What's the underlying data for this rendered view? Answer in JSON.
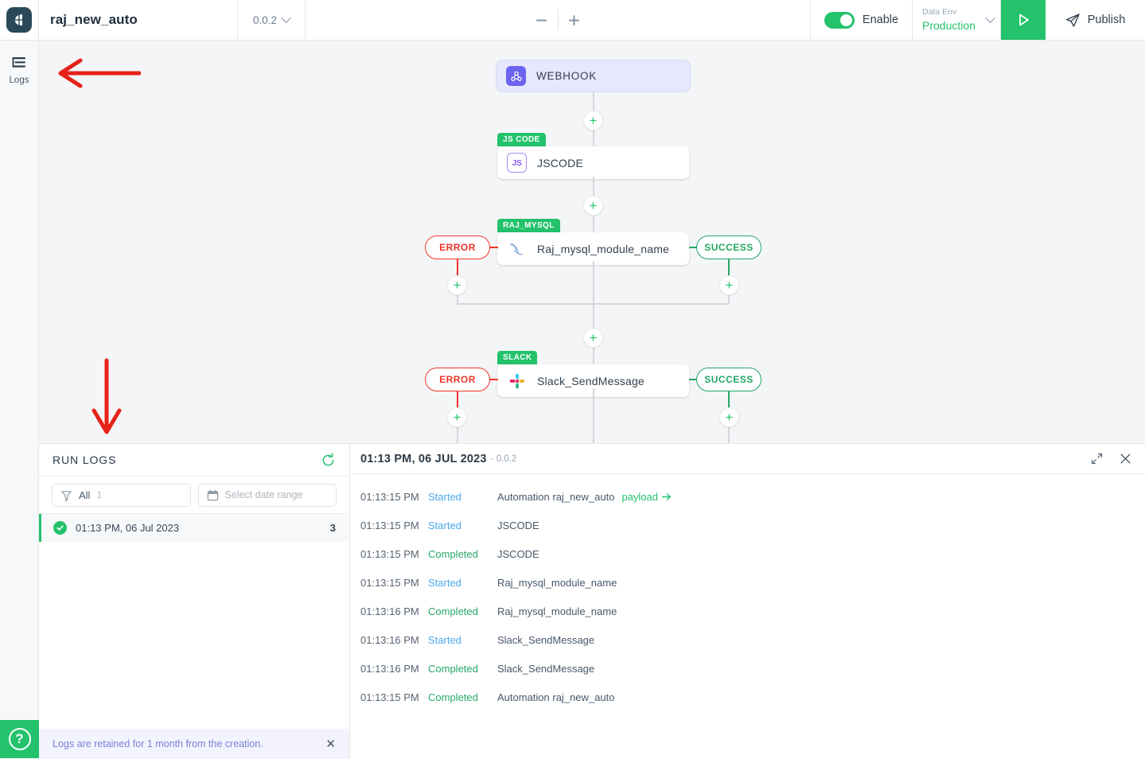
{
  "topbar": {
    "logo_icon": "app-logo-icon",
    "automation_title": "raj_new_auto",
    "version": "0.0.2",
    "version_chevron_icon": "chevron-down-icon",
    "zoom_out_icon": "minus-icon",
    "zoom_in_icon": "plus-icon",
    "enable_label": "Enable",
    "enable_toggle_state": "on",
    "data_env_label": "Data Env",
    "data_env_value": "Production",
    "data_env_chevron_icon": "chevron-down-icon",
    "run_icon": "play-icon",
    "publish_label": "Publish",
    "publish_icon": "send-icon"
  },
  "sidebar": {
    "items": [
      {
        "label": "Logs",
        "icon": "logs-icon"
      }
    ],
    "help_icon": "question-mark-icon"
  },
  "canvas": {
    "nodes": [
      {
        "id": "webhook",
        "tag": "",
        "title": "WEBHOOK",
        "icon": "webhook-icon"
      },
      {
        "id": "jscode",
        "tag": "JS CODE",
        "title": "JSCODE",
        "icon": "js-icon"
      },
      {
        "id": "mysql",
        "tag": "RAJ_MYSQL",
        "title": "Raj_mysql_module_name",
        "icon": "mysql-dolphin-icon"
      },
      {
        "id": "slack",
        "tag": "SLACK",
        "title": "Slack_SendMessage",
        "icon": "slack-icon"
      }
    ],
    "branch_error_label": "ERROR",
    "branch_success_label": "SUCCESS",
    "add_step_label": "+"
  },
  "runlogs": {
    "panel_title": "RUN LOGS",
    "refresh_icon": "refresh-icon",
    "filter_icon": "filter-icon",
    "filter_label": "All",
    "filter_count": "1",
    "calendar_icon": "calendar-icon",
    "date_placeholder": "Select date range",
    "items": [
      {
        "label": "01:13 PM, 06 Jul 2023",
        "count": "3",
        "status_icon": "check-circle-icon"
      }
    ],
    "retention_notice": "Logs are retained for 1 month from the creation.",
    "retention_close_icon": "close-icon"
  },
  "detail": {
    "title": "01:13 PM, 06 JUL 2023",
    "version_suffix": "- 0.0.2",
    "expand_icon": "expand-icon",
    "close_icon": "close-icon",
    "payload_label": "payload",
    "payload_arrow_icon": "arrow-right-icon",
    "rows": [
      {
        "time": "01:13:15 PM",
        "status": "Started",
        "status_kind": "started",
        "message": "Automation raj_new_auto",
        "payload": true
      },
      {
        "time": "01:13:15 PM",
        "status": "Started",
        "status_kind": "started",
        "message": "JSCODE",
        "payload": false
      },
      {
        "time": "01:13:15 PM",
        "status": "Completed",
        "status_kind": "completed",
        "message": "JSCODE",
        "payload": false
      },
      {
        "time": "01:13:15 PM",
        "status": "Started",
        "status_kind": "started",
        "message": "Raj_mysql_module_name",
        "payload": false
      },
      {
        "time": "01:13:16 PM",
        "status": "Completed",
        "status_kind": "completed",
        "message": "Raj_mysql_module_name",
        "payload": false
      },
      {
        "time": "01:13:16 PM",
        "status": "Started",
        "status_kind": "started",
        "message": "Slack_SendMessage",
        "payload": false
      },
      {
        "time": "01:13:16 PM",
        "status": "Completed",
        "status_kind": "completed",
        "message": "Slack_SendMessage",
        "payload": false
      },
      {
        "time": "01:13:15 PM",
        "status": "Completed",
        "status_kind": "completed",
        "message": "Automation raj_new_auto",
        "payload": false
      }
    ]
  },
  "annotations": [
    {
      "type": "arrow-left",
      "color": "#e62219"
    },
    {
      "type": "arrow-down",
      "color": "#e62219"
    }
  ],
  "colors": {
    "accent_green": "#23c26b",
    "error_red": "#f0352b",
    "success_green": "#23a765",
    "webhook_purple": "#6c63f0",
    "canvas_bg": "#f4f5f6"
  }
}
